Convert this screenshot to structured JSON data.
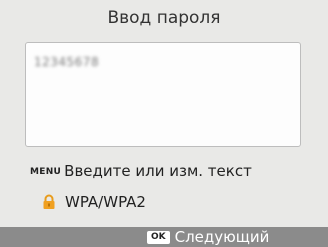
{
  "screen": {
    "title": "Ввод пароля"
  },
  "password_field": {
    "value": "12345678"
  },
  "hint": {
    "key_label": "MENU",
    "text": "Введите или изм. текст"
  },
  "security": {
    "icon": "lock-icon",
    "type": "WPA/WPA2",
    "icon_color": "#f0a020"
  },
  "footer": {
    "key_label": "OK",
    "next_label": "Следующий",
    "background": "#8b8b8b"
  }
}
